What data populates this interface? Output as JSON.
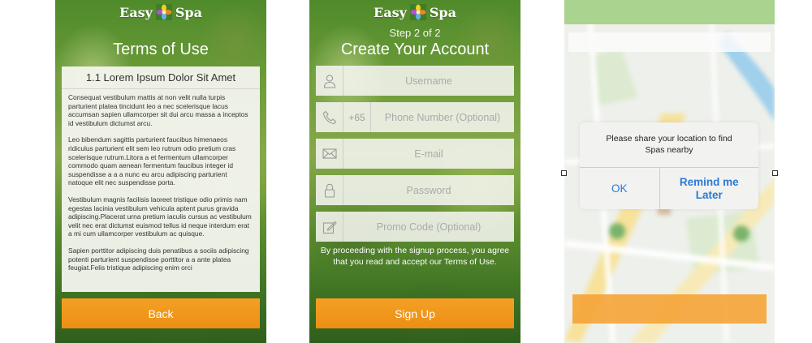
{
  "brand": {
    "word1": "Easy",
    "word2": "Spa",
    "flower_colors": [
      "#f6d21b",
      "#e9862a",
      "#5fb3e6",
      "#b64fd0"
    ]
  },
  "screen1": {
    "title": "Terms of Use",
    "section_heading": "1.1 Lorem Ipsum Dolor Sit Amet",
    "paragraphs": [
      "Consequat vestibulum mattis at non velit nulla turpis parturient platea tincidunt leo a nec scelerisque lacus accumsan sapien ullamcorper sit dui arcu massa a inceptos id vestibulum dictumst arcu.",
      "Leo bibendum sagittis parturient faucibus himenaeos ridiculus parturient elit sem leo rutrum odio pretium cras scelerisque rutrum.Litora a et fermentum ullamcorper commodo quam aenean fermentum faucibus integer id suspendisse a a a nunc eu arcu adipiscing parturient natoque elit nec suspendisse porta.",
      "Vestibulum magnis facilisis laoreet tristique odio primis nam egestas lacinia vestibulum vehicula aptent purus gravida adipiscing.Placerat urna pretium iaculis cursus ac vestibulum velit nec erat dictumst euismod tellus id neque interdum erat a mi cum ullamcorper vestibulum ac quisque.",
      "Sapien porttitor adipiscing duis penatibus a sociis adipiscing potenti parturient suspendisse porttitor a a ante platea feugiat.Felis tristique adipiscing enim orci"
    ],
    "back_label": "Back"
  },
  "screen2": {
    "step": "Step 2 of 2",
    "title": "Create Your Account",
    "fields": {
      "username": {
        "placeholder": "Username",
        "icon": "person-icon"
      },
      "phone": {
        "prefix": "+65",
        "placeholder": "Phone Number (Optional)",
        "icon": "phone-icon"
      },
      "email": {
        "placeholder": "E-mail",
        "icon": "envelope-icon"
      },
      "password": {
        "placeholder": "Password",
        "icon": "lock-icon"
      },
      "promo": {
        "placeholder": "Promo Code (Optional)",
        "icon": "pencil-icon"
      }
    },
    "consent": "By proceeding with the signup process, you agree that you read and accept our Terms of Use.",
    "signup_label": "Sign Up"
  },
  "screen3": {
    "alert_message": "Please share your location to find Spas nearby",
    "ok_label": "OK",
    "remind_label": "Remind me Later"
  },
  "colors": {
    "orange": "#ef9518",
    "alert_blue": "#2a7ad6",
    "topbar_green": "#8cc46a"
  }
}
